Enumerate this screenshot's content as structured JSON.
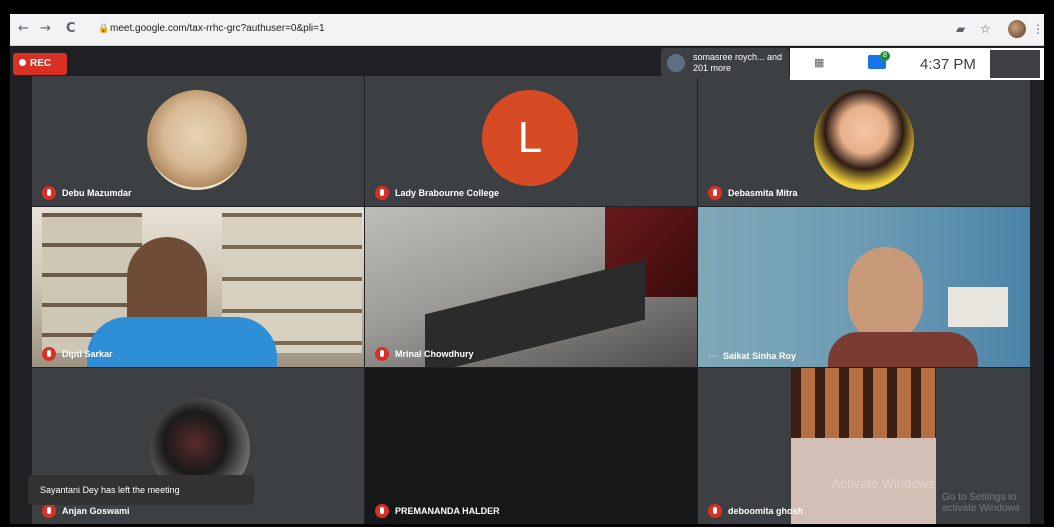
{
  "browser": {
    "back": "←",
    "forward": "→",
    "reload": "C",
    "url": "meet.google.com/tax-rrhc-grc?authuser=0&pli=1",
    "lock": "🔒",
    "icons": [
      "key-icon",
      "star-icon",
      "profile-icon",
      "menu-icon"
    ],
    "star": "☆",
    "menu": "⋮",
    "key": "▰"
  },
  "meeting": {
    "recording": "REC",
    "participants_text": "somasree roych... and 201 more",
    "people_icon": "▦",
    "chat_badge": "8",
    "time": "4:37 PM",
    "toast": "Sayantani Dey has left the meeting",
    "watermark_line1": "Activate Windows",
    "watermark_line2": "Go to Settings to activate Windows"
  },
  "tiles": [
    {
      "name": "Debu Mazumdar",
      "type": "avatar"
    },
    {
      "name": "Lady Brabourne College",
      "type": "letter",
      "letter": "L",
      "color": "#d64a24"
    },
    {
      "name": "Debasmita Mitra",
      "type": "avatar"
    },
    {
      "name": "Dipti Sarkar",
      "type": "video"
    },
    {
      "name": "Mrinal Chowdhury",
      "type": "video"
    },
    {
      "name": "Saikat Sinha Roy",
      "type": "video"
    },
    {
      "name": "Anjan Goswami",
      "type": "avatar"
    },
    {
      "name": "PREMANANDA HALDER",
      "type": "blank"
    },
    {
      "name": "deboomita ghosh",
      "type": "video"
    }
  ],
  "colors": {
    "accent": "#1a73e8",
    "rec": "#d93025",
    "stage": "#202124"
  }
}
